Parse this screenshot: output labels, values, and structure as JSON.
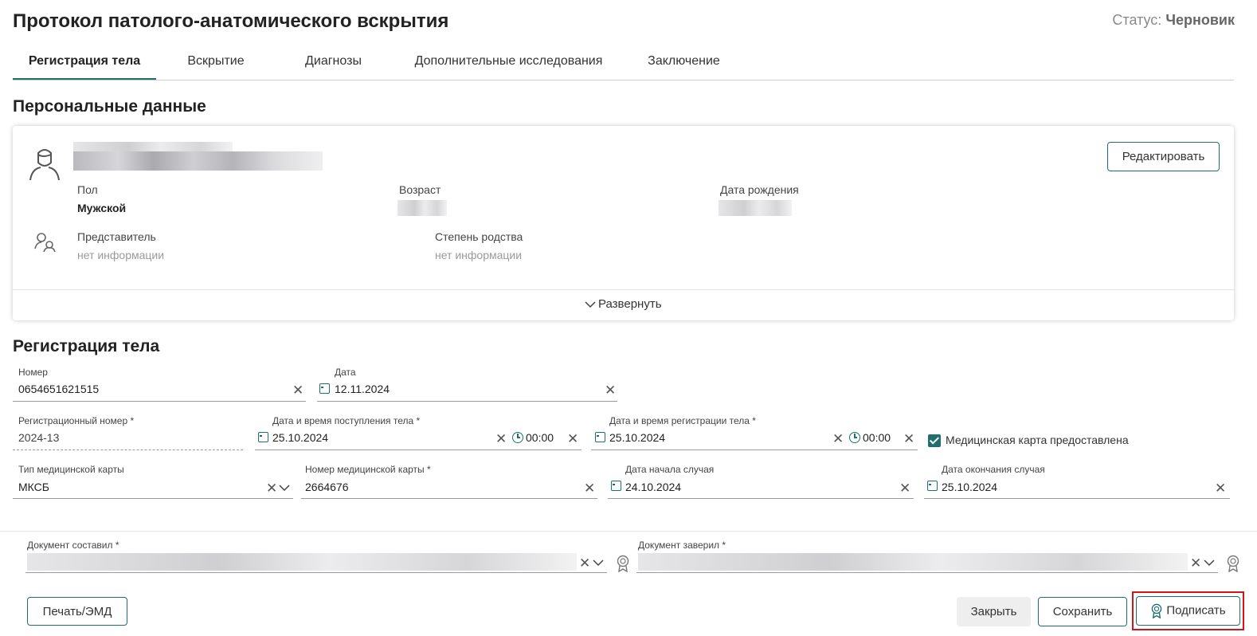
{
  "header": {
    "title": "Протокол патолого-анатомического вскрытия",
    "status_label": "Статус:",
    "status_value": "Черновик"
  },
  "tabs": [
    {
      "label": "Регистрация тела",
      "active": true
    },
    {
      "label": "Вскрытие",
      "active": false
    },
    {
      "label": "Диагнозы",
      "active": false
    },
    {
      "label": "Дополнительные исследования",
      "active": false
    },
    {
      "label": "Заключение",
      "active": false
    }
  ],
  "personal": {
    "section_title": "Персональные данные",
    "edit_button": "Редактировать",
    "sex_label": "Пол",
    "sex_value": "Мужской",
    "age_label": "Возраст",
    "birth_label": "Дата рождения",
    "rep_label": "Представитель",
    "rep_value": "нет информации",
    "kin_label": "Степень родства",
    "kin_value": "нет информации",
    "expand_label": "Развернуть"
  },
  "registration": {
    "section_title": "Регистрация тела",
    "number": {
      "label": "Номер",
      "value": "0654651621515"
    },
    "date": {
      "label": "Дата",
      "value": "12.11.2024"
    },
    "reg_number": {
      "label": "Регистрационный номер *",
      "value": "2024-13"
    },
    "arrival": {
      "label": "Дата и время поступления тела *",
      "date": "25.10.2024",
      "time": "00:00"
    },
    "registration_dt": {
      "label": "Дата и время регистрации тела *",
      "date": "25.10.2024",
      "time": "00:00"
    },
    "med_card_provided": {
      "label": "Медицинская карта предоставлена",
      "checked": true
    },
    "card_type": {
      "label": "Тип медицинской карты",
      "value": "МКСБ"
    },
    "card_number": {
      "label": "Номер медицинской карты *",
      "value": "2664676"
    },
    "case_start": {
      "label": "Дата начала случая",
      "value": "24.10.2024"
    },
    "case_end": {
      "label": "Дата окончания случая",
      "value": "25.10.2024"
    }
  },
  "footer": {
    "composed_label": "Документ составил *",
    "certified_label": "Документ заверил *",
    "print_button": "Печать/ЭМД",
    "close_button": "Закрыть",
    "save_button": "Сохранить",
    "sign_button": "Подписать"
  },
  "colors": {
    "accent": "#1f6f6f",
    "highlight": "#d0151b"
  }
}
